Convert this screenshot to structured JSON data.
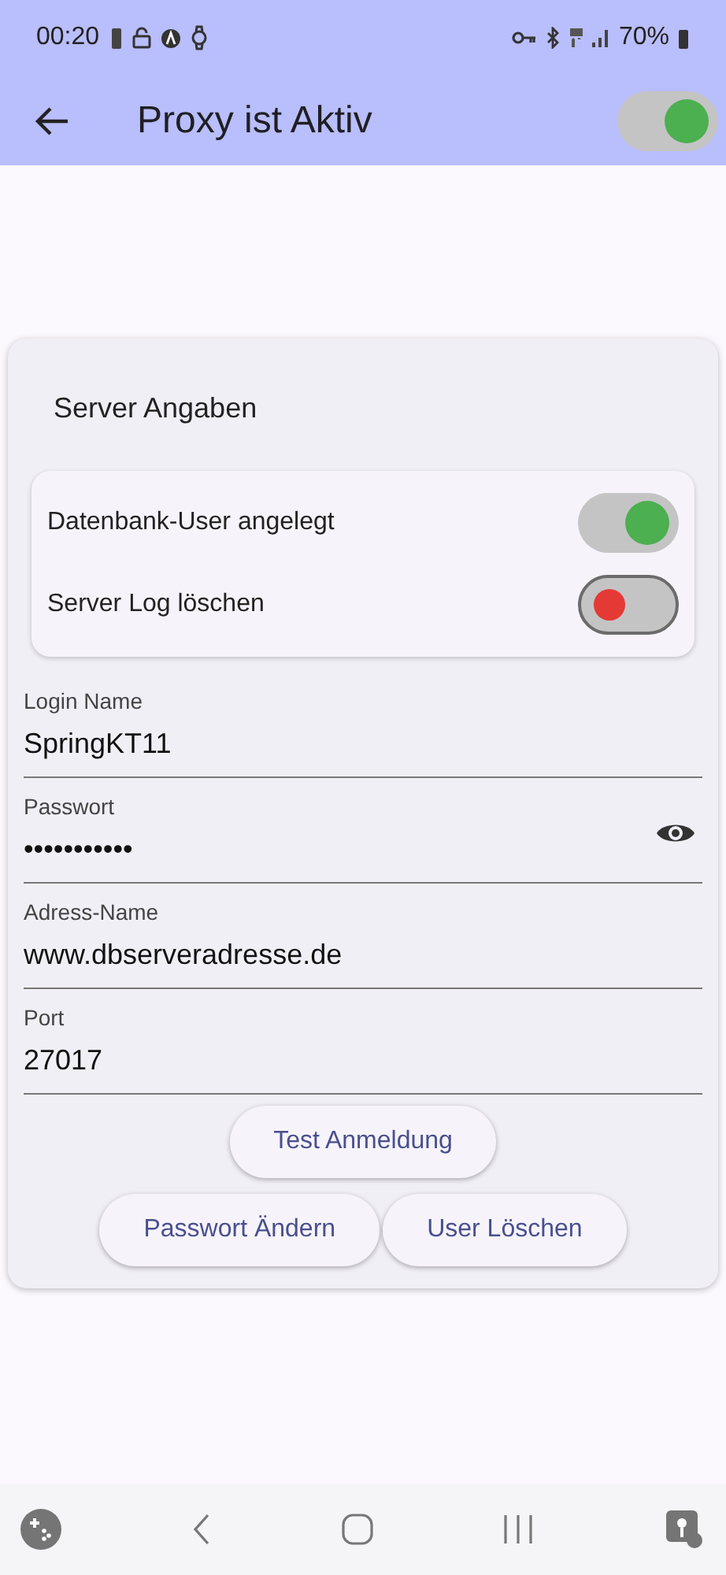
{
  "status_bar": {
    "time": "00:20",
    "battery": "70%"
  },
  "app_bar": {
    "title": "Proxy ist Aktiv",
    "toggle_on": true
  },
  "card": {
    "title": "Server Angaben",
    "switches": [
      {
        "label": "Datenbank-User angelegt",
        "on": true
      },
      {
        "label": "Server Log löschen",
        "on": false
      }
    ],
    "fields": [
      {
        "label": "Login Name",
        "value": "SpringKT11",
        "kind": "text"
      },
      {
        "label": "Passwort",
        "value": "•••••••••••",
        "kind": "password"
      },
      {
        "label": "Adress-Name",
        "value": "www.dbserveradresse.de",
        "kind": "text"
      },
      {
        "label": "Port",
        "value": "27017",
        "kind": "text"
      }
    ],
    "button_rows": [
      [
        "Test Anmeldung"
      ],
      [
        "Passwort Ändern",
        "User Löschen"
      ]
    ]
  }
}
